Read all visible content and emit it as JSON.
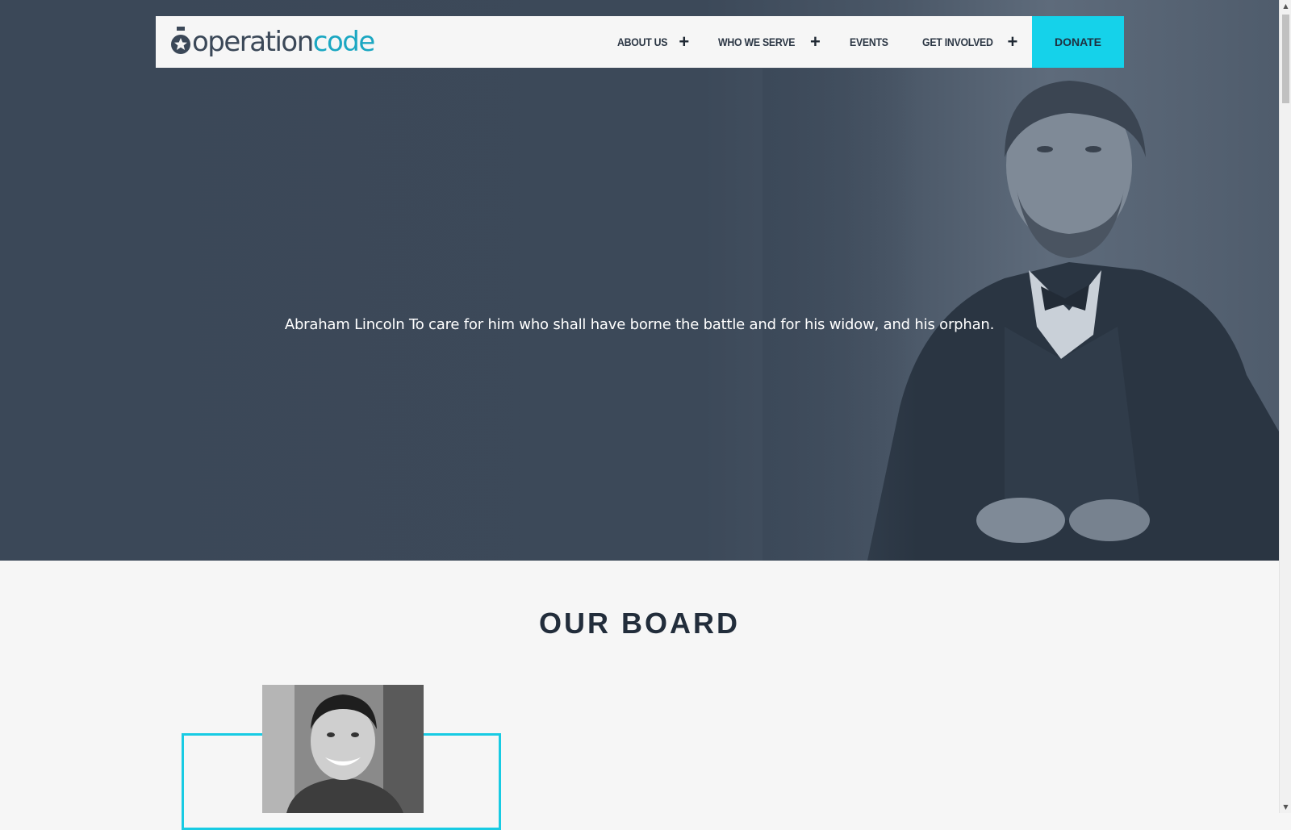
{
  "nav": {
    "logo_part1": "operation",
    "logo_part2": "code",
    "items": [
      {
        "label": "ABOUT US",
        "has_submenu": true
      },
      {
        "label": "WHO WE SERVE",
        "has_submenu": true
      },
      {
        "label": "EVENTS",
        "has_submenu": false
      },
      {
        "label": "GET INVOLVED",
        "has_submenu": true
      }
    ],
    "plus_symbol": "+",
    "donate_label": "DONATE"
  },
  "hero": {
    "quote": "Abraham Lincoln To care for him who shall have borne the battle and for his widow, and his orphan."
  },
  "board": {
    "title": "OUR BOARD"
  },
  "colors": {
    "accent": "#15d2ea",
    "brand_dark": "#3b4858",
    "brand_teal": "#1ba7c2"
  }
}
